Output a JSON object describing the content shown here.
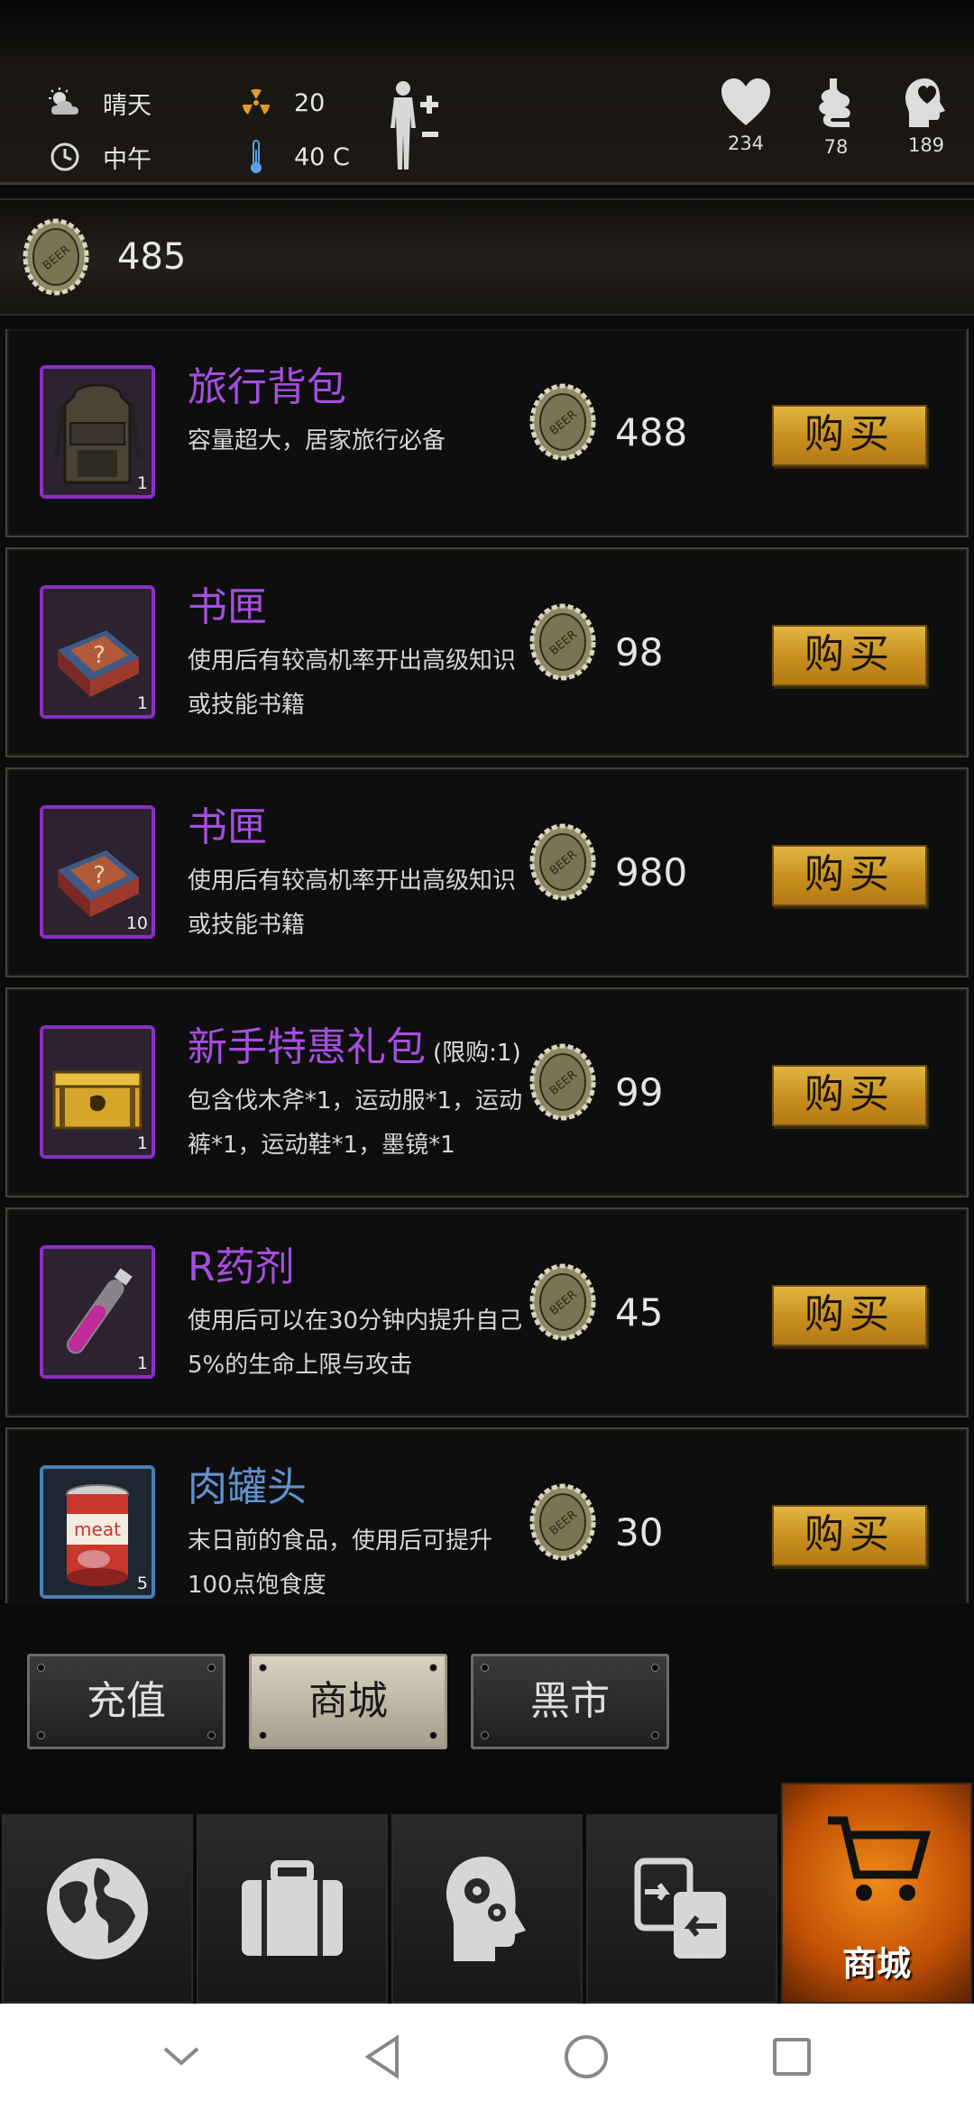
{
  "status": {
    "weather": "晴天",
    "time_of_day": "中午",
    "radiation": "20",
    "temperature": "40 C",
    "health": "234",
    "hunger": "78",
    "sanity": "189"
  },
  "currency": {
    "amount": "485",
    "icon": "beer-cap-coin-icon"
  },
  "items": [
    {
      "name": "旅行背包",
      "limit": "",
      "desc": "容量超大，居家旅行必备",
      "qty": "1",
      "price": "488",
      "buy_label": "购买",
      "rarity": "purple",
      "icon": "backpack-icon"
    },
    {
      "name": "书匣",
      "limit": "",
      "desc": "使用后有较高机率开出高级知识或技能书籍",
      "qty": "1",
      "price": "98",
      "buy_label": "购买",
      "rarity": "purple",
      "icon": "book-box-icon"
    },
    {
      "name": "书匣",
      "limit": "",
      "desc": "使用后有较高机率开出高级知识或技能书籍",
      "qty": "10",
      "price": "980",
      "buy_label": "购买",
      "rarity": "purple",
      "icon": "book-box-icon"
    },
    {
      "name": "新手特惠礼包",
      "limit": "(限购:1)",
      "desc": "包含伐木斧*1，运动服*1，运动裤*1，运动鞋*1，墨镜*1",
      "qty": "1",
      "price": "99",
      "buy_label": "购买",
      "rarity": "purple",
      "icon": "gift-crate-icon"
    },
    {
      "name": "R药剂",
      "limit": "",
      "desc": "使用后可以在30分钟内提升自己5%的生命上限与攻击",
      "qty": "1",
      "price": "45",
      "buy_label": "购买",
      "rarity": "purple",
      "icon": "potion-vial-icon"
    },
    {
      "name": "肉罐头",
      "limit": "",
      "desc": "末日前的食品，使用后可提升100点饱食度",
      "qty": "5",
      "price": "30",
      "buy_label": "购买",
      "rarity": "blue",
      "icon": "meat-can-icon"
    }
  ],
  "shop_tabs": [
    {
      "label": "充值",
      "active": false
    },
    {
      "label": "商城",
      "active": true
    },
    {
      "label": "黑市",
      "active": false
    }
  ],
  "bottom_nav": [
    {
      "icon": "globe-icon",
      "label": ""
    },
    {
      "icon": "suitcase-icon",
      "label": ""
    },
    {
      "icon": "head-gears-icon",
      "label": ""
    },
    {
      "icon": "transfer-icon",
      "label": ""
    },
    {
      "icon": "shopping-cart-icon",
      "label": "商城",
      "active": true
    }
  ],
  "colors": {
    "purple_rarity": "#a64fe0",
    "blue_rarity": "#5f93cf",
    "buy_gold": "#d4a22c",
    "nav_active": "#e67514"
  }
}
